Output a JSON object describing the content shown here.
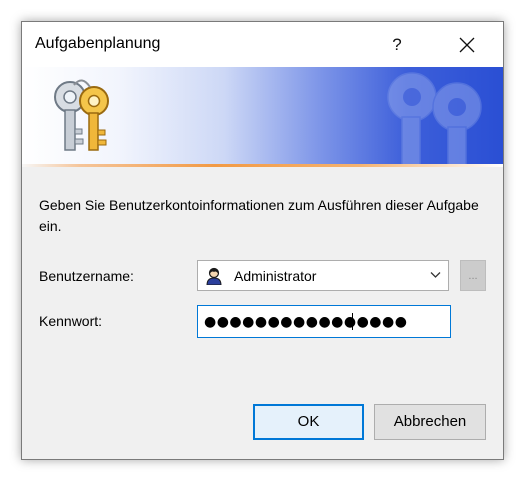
{
  "window": {
    "title": "Aufgabenplanung",
    "help_label": "?"
  },
  "banner": {
    "icon": "keys-icon",
    "watermark_icon": "keys-watermark-icon",
    "colors": {
      "gradient_end": "#2a4fd4",
      "accent_line": "#f29a45"
    }
  },
  "instruction": "Geben Sie Benutzerkontoinformationen zum Ausführen dieser Aufgabe ein.",
  "form": {
    "username_label": "Benutzername:",
    "username_value": "Administrator",
    "username_icon": "user-icon",
    "browse_label": "...",
    "password_label": "Kennwort:",
    "password_value": "●●●●●●●●●●●●●●●●"
  },
  "buttons": {
    "ok": "OK",
    "cancel": "Abbrechen"
  },
  "colors": {
    "focus": "#0078d7",
    "dialog_bg": "#f0f0f0"
  }
}
